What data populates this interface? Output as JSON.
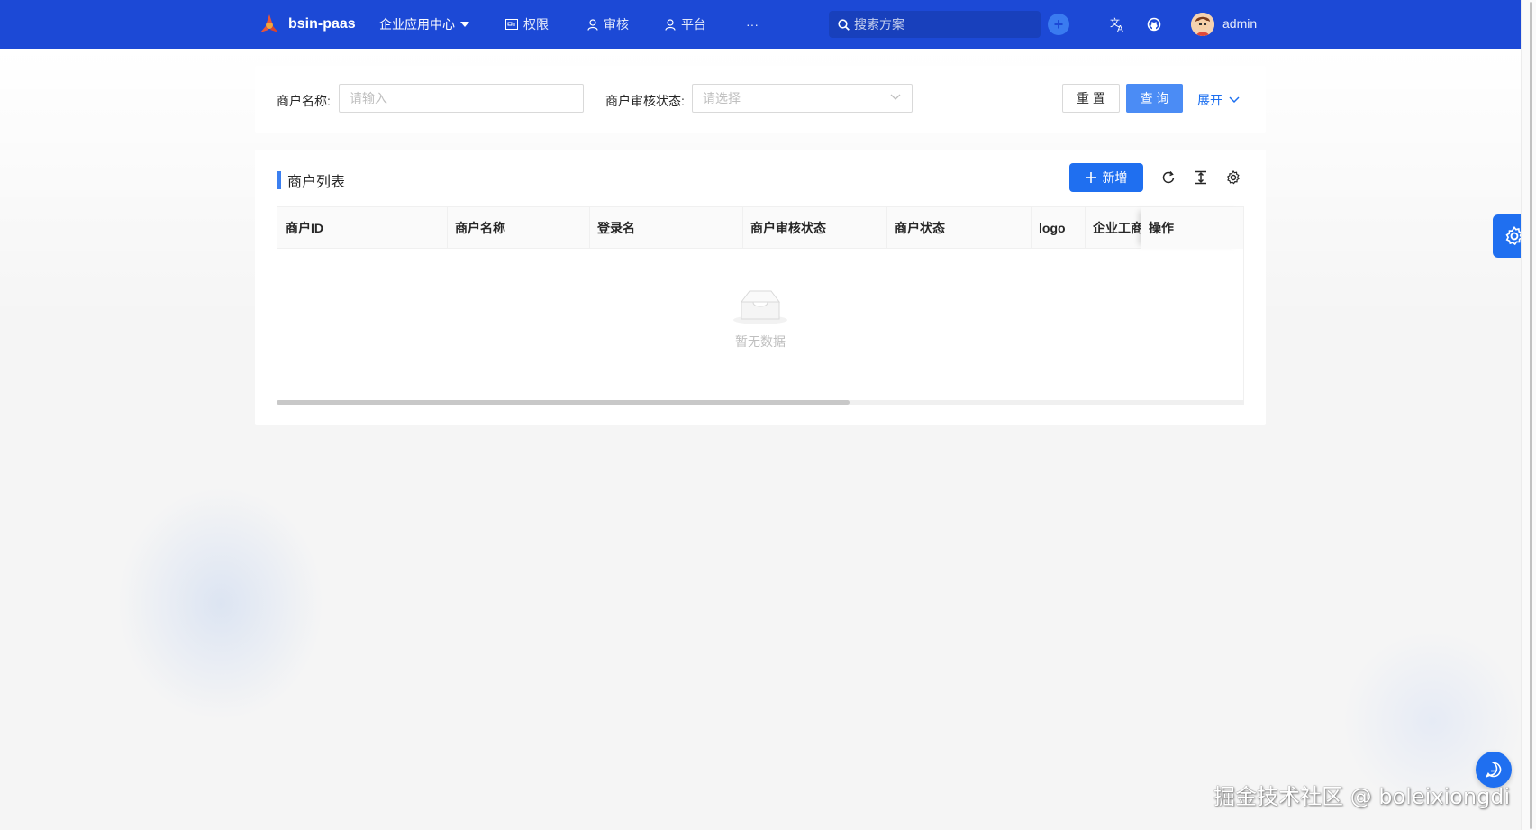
{
  "header": {
    "app_name": "bsin-paas",
    "menu_center": "企业应用中心",
    "nav": [
      "权限",
      "审核",
      "平台"
    ],
    "more": "···",
    "search_placeholder": "搜索方案",
    "username": "admin"
  },
  "filter": {
    "merchant_name_label": "商户名称:",
    "merchant_name_placeholder": "请输入",
    "audit_status_label": "商户审核状态:",
    "audit_status_placeholder": "请选择",
    "reset_label": "重 置",
    "query_label": "查 询",
    "expand_label": "展开"
  },
  "list": {
    "title": "商户列表",
    "new_label": "新增",
    "columns": [
      "商户ID",
      "商户名称",
      "登录名",
      "商户审核状态",
      "商户状态",
      "logo",
      "企业工商",
      "操作"
    ],
    "empty_text": "暂无数据"
  },
  "watermark": "掘金技术社区 @ boleixiongdi",
  "colors": {
    "header_bg": "#1c49d6",
    "primary": "#1f6ff0",
    "query_button": "#4b8cf5"
  }
}
